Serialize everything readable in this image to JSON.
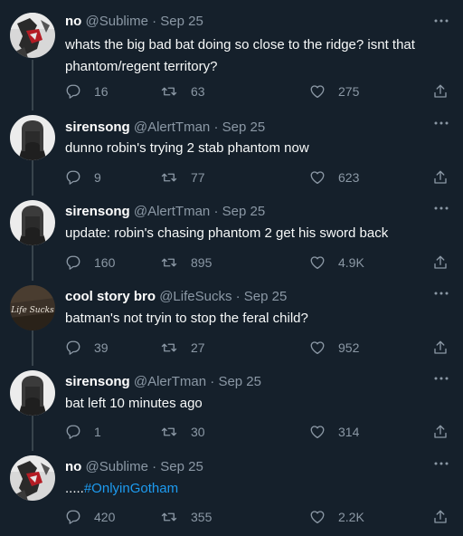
{
  "tweets": [
    {
      "name": "no",
      "handle": "@Sublime",
      "separator": "·",
      "date": "Sep 25",
      "text": "whats the big bad bat doing so close to the ridge? isnt that phantom/regent territory?",
      "replies": "16",
      "retweets": "63",
      "likes": "275"
    },
    {
      "name": "sirensong",
      "handle": "@AlertTman",
      "separator": "·",
      "date": "Sep 25",
      "text": "dunno robin's trying 2 stab phantom now",
      "replies": "9",
      "retweets": "77",
      "likes": "623"
    },
    {
      "name": "sirensong",
      "handle": "@AlertTman",
      "separator": "·",
      "date": "Sep 25",
      "text": "update: robin's chasing phantom 2 get his sword back",
      "replies": "160",
      "retweets": "895",
      "likes": "4.9K"
    },
    {
      "name": "cool story bro",
      "handle": "@LifeSucks",
      "separator": "·",
      "date": "Sep 25",
      "text": "batman's not tryin to stop the feral child?",
      "replies": "39",
      "retweets": "27",
      "likes": "952",
      "avatar_text": "Life Sucks"
    },
    {
      "name": "sirensong",
      "handle": "@AlerTman",
      "separator": "·",
      "date": "Sep 25",
      "text": "bat left 10 minutes ago",
      "replies": "1",
      "retweets": "30",
      "likes": "314"
    },
    {
      "name": "no",
      "handle": "@Sublime",
      "separator": "·",
      "date": "Sep 25",
      "text_prefix": ".....",
      "hashtag": "#OnlyinGotham",
      "replies": "420",
      "retweets": "355",
      "likes": "2.2K"
    }
  ],
  "colors": {
    "background": "#15202b",
    "text": "#f7f9f9",
    "secondary": "#8b98a5",
    "link": "#1d9bf0",
    "thread_line": "#38444d"
  },
  "icons": {
    "reply": "reply-icon",
    "retweet": "retweet-icon",
    "like": "heart-icon",
    "share": "share-icon",
    "more": "more-icon"
  }
}
